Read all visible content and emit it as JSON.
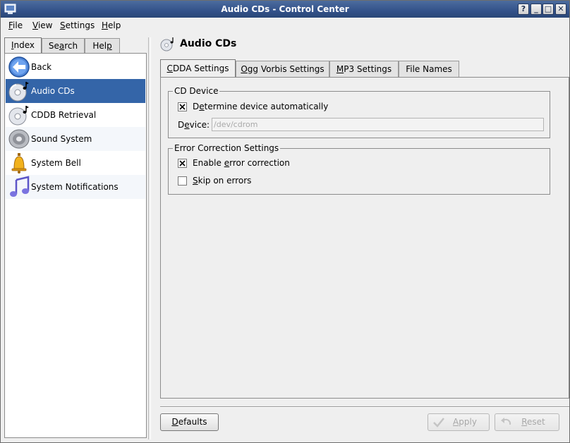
{
  "window": {
    "title": "Audio CDs - Control Center"
  },
  "title_buttons": {
    "help": "?",
    "minimize": "_",
    "maximize": "□",
    "close": "✕"
  },
  "menubar": {
    "file": {
      "pre": "",
      "key": "F",
      "post": "ile"
    },
    "view": {
      "pre": "",
      "key": "V",
      "post": "iew"
    },
    "settings": {
      "pre": "",
      "key": "S",
      "post": "ettings"
    },
    "help": {
      "pre": "",
      "key": "H",
      "post": "elp"
    }
  },
  "left_tabs": [
    {
      "pre": "",
      "key": "I",
      "post": "ndex"
    },
    {
      "pre": "Se",
      "key": "a",
      "post": "rch"
    },
    {
      "pre": "Hel",
      "key": "p",
      "post": ""
    }
  ],
  "index": {
    "items": [
      {
        "label": "Back"
      },
      {
        "label": "Audio CDs"
      },
      {
        "label": "CDDB Retrieval"
      },
      {
        "label": "Sound System"
      },
      {
        "label": "System Bell"
      },
      {
        "label": "System Notifications"
      }
    ]
  },
  "module": {
    "title": "Audio CDs"
  },
  "right_tabs": [
    {
      "pre": "",
      "key": "C",
      "post": "DDA Settings"
    },
    {
      "pre": "",
      "key": "O",
      "post": "gg Vorbis Settings"
    },
    {
      "pre": "",
      "key": "M",
      "post": "P3 Settings"
    },
    {
      "pre": "File Names",
      "key": "",
      "post": ""
    }
  ],
  "cd_device": {
    "title": "CD Device",
    "auto_detect": {
      "pre": "D",
      "key": "e",
      "post": "termine device automatically",
      "checked": true
    },
    "device_label": {
      "pre": "D",
      "key": "e",
      "post": "vice:"
    },
    "device_value": "/dev/cdrom"
  },
  "error_correction": {
    "title": "Error Correction Settings",
    "enable": {
      "pre": "Enable ",
      "key": "e",
      "post": "rror correction",
      "checked": true
    },
    "skip": {
      "pre": "",
      "key": "S",
      "post": "kip on errors",
      "checked": false
    }
  },
  "buttons": {
    "defaults": {
      "pre": "",
      "key": "D",
      "post": "efaults"
    },
    "apply": {
      "pre": "",
      "key": "A",
      "post": "pply"
    },
    "reset": {
      "pre": "",
      "key": "R",
      "post": "eset"
    }
  },
  "colors": {
    "selection": "#3465a8",
    "titlebar": "#33528a"
  }
}
